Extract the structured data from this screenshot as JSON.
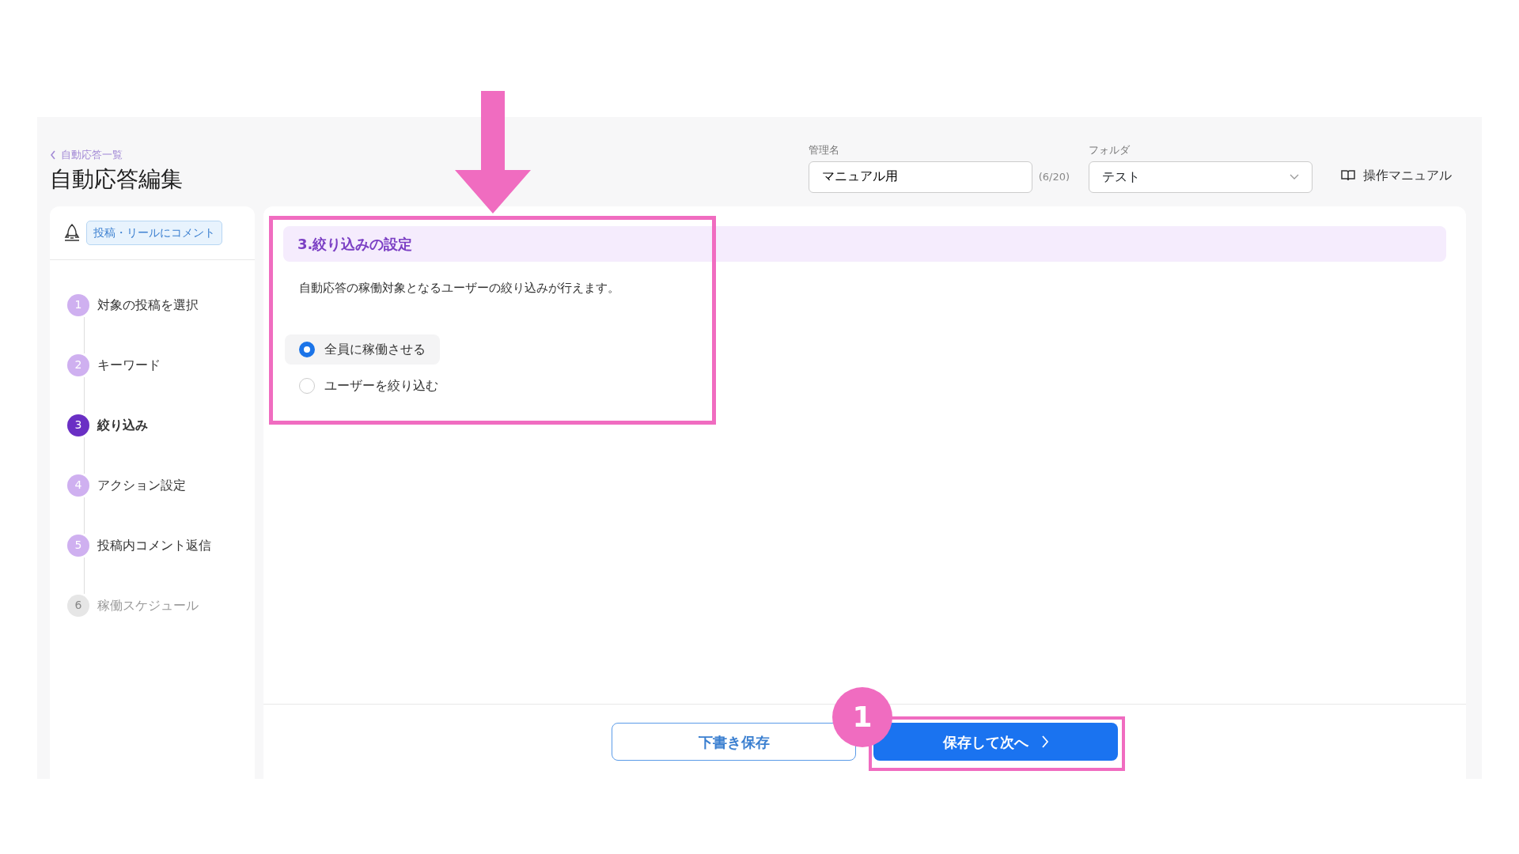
{
  "breadcrumb": {
    "label": "自動応答一覧"
  },
  "title": "自動応答編集",
  "name_field": {
    "label": "管理名",
    "value": "マニュアル用",
    "counter": "(6/20)"
  },
  "folder_field": {
    "label": "フォルダ",
    "value": "テスト"
  },
  "manual_link": {
    "label": "操作マニュアル"
  },
  "sidebar": {
    "type_tag": "投稿・リールにコメント",
    "steps": [
      {
        "number": "1",
        "label": "対象の投稿を選択",
        "selected": false,
        "disabled": false
      },
      {
        "number": "2",
        "label": "キーワード",
        "selected": false,
        "disabled": false
      },
      {
        "number": "3",
        "label": "絞り込み",
        "selected": true,
        "disabled": false
      },
      {
        "number": "4",
        "label": "アクション設定",
        "selected": false,
        "disabled": false
      },
      {
        "number": "5",
        "label": "投稿内コメント返信",
        "selected": false,
        "disabled": false
      },
      {
        "number": "6",
        "label": "稼働スケジュール",
        "selected": false,
        "disabled": true
      }
    ]
  },
  "section": {
    "heading": "3.絞り込みの設定",
    "description": "自動応答の稼働対象となるユーザーの絞り込みが行えます。",
    "options": [
      {
        "label": "全員に稼働させる",
        "selected": true
      },
      {
        "label": "ユーザーを絞り込む",
        "selected": false
      }
    ]
  },
  "footer": {
    "buttons": [
      {
        "label": "下書き保存",
        "kind": "outline"
      },
      {
        "label": "保存して次へ",
        "kind": "primary"
      }
    ]
  },
  "annotation": {
    "badge": "1"
  }
}
